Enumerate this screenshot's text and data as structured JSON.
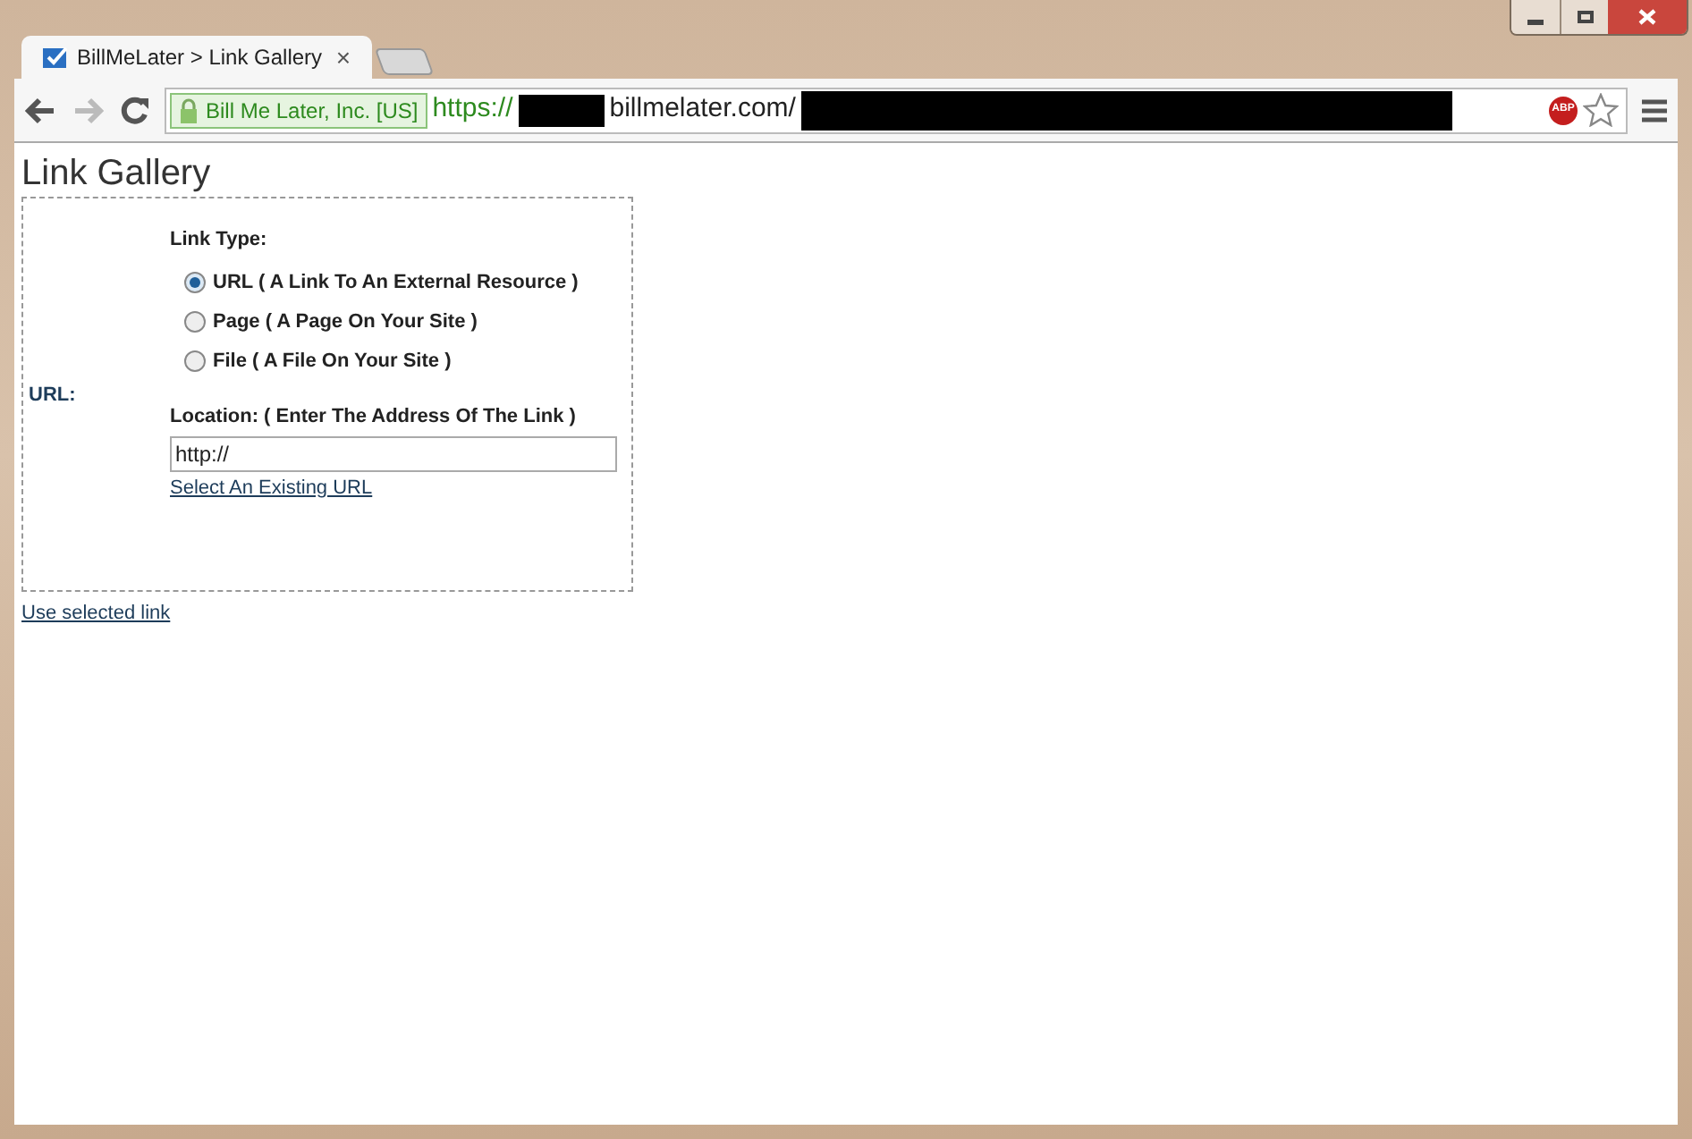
{
  "browser": {
    "tab_title": "BillMeLater > Link Gallery",
    "tab_close": "×",
    "security_label": "Bill Me Later, Inc. [US]",
    "url_scheme": "https://",
    "url_domain": "billmelater.com/",
    "adblock_badge": "ABP"
  },
  "page": {
    "heading": "Link Gallery",
    "field_label": "URL:",
    "link_type_label": "Link Type:",
    "link_types": [
      {
        "label": "URL ( A Link To An External Resource )",
        "selected": true
      },
      {
        "label": "Page ( A Page On Your Site )",
        "selected": false
      },
      {
        "label": "File ( A File On Your Site )",
        "selected": false
      }
    ],
    "location_label": "Location: ( Enter The Address Of The Link )",
    "location_value": "http://",
    "select_existing_link": "Select An Existing URL",
    "use_selected_link": "Use selected link"
  }
}
